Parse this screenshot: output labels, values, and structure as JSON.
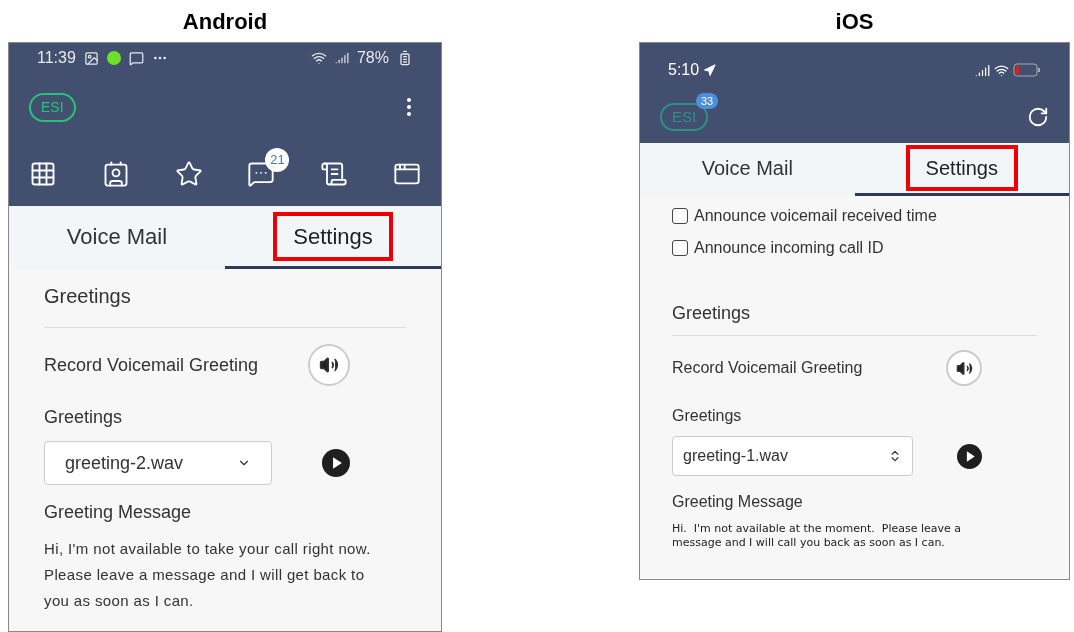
{
  "panels": [
    {
      "kind": "android",
      "heading": "Android",
      "status_bar": {
        "time": "11:39",
        "battery": "78%"
      },
      "app_bar": {
        "account": "ESI"
      },
      "toolbar": [
        {
          "kind": "dialpad"
        },
        {
          "kind": "contacts"
        },
        {
          "kind": "favorites"
        },
        {
          "kind": "chat",
          "badge": "21"
        },
        {
          "kind": "document"
        },
        {
          "kind": "window"
        }
      ],
      "tabs": [
        {
          "label": "Voice Mail",
          "selected": false,
          "highlighted": false
        },
        {
          "label": "Settings",
          "selected": true,
          "highlighted": true
        }
      ],
      "section_title": "Greetings",
      "record_label": "Record Voicemail Greeting",
      "greetings_label": "Greetings",
      "greeting_select": {
        "value": "greeting-2.wav"
      },
      "message_label": "Greeting Message",
      "message": "Hi, I'm not available to take your call right now. Please leave a message and I will get back to you as soon as I can."
    },
    {
      "kind": "ios",
      "heading": "iOS",
      "status_bar": {
        "time": "5:10"
      },
      "app_bar": {
        "account": "ESI",
        "account_badge": "33"
      },
      "tabs": [
        {
          "label": "Voice Mail",
          "selected": false,
          "highlighted": false
        },
        {
          "label": "Settings",
          "selected": true,
          "highlighted": true
        }
      ],
      "options": [
        {
          "label": "Announce voicemail received time",
          "checked": false
        },
        {
          "label": "Announce incoming call ID",
          "checked": false
        }
      ],
      "section_title": "Greetings",
      "record_label": "Record Voicemail Greeting",
      "greetings_label": "Greetings",
      "greeting_select": {
        "value": "greeting-1.wav"
      },
      "message_label": "Greeting Message",
      "message": "Hi.  I'm not available at the moment.  Please leave a message and I will call you back as soon as I can."
    }
  ]
}
